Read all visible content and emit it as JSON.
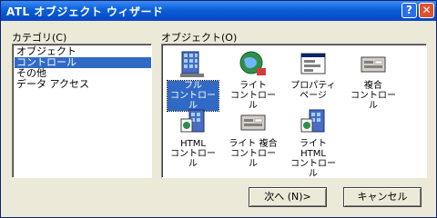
{
  "window": {
    "title": "ATL オブジェクト ウィザード",
    "help_label": "?",
    "close_label": "✕"
  },
  "category": {
    "label": "カテゴリ(C)",
    "items": [
      {
        "label": "オブジェクト"
      },
      {
        "label": "コントロール"
      },
      {
        "label": "その他"
      },
      {
        "label": "データ アクセス"
      }
    ],
    "selected": "コントロール"
  },
  "objects": {
    "label": "オブジェクト(O)",
    "items": [
      {
        "label": "フル\nコントロール",
        "icon": "full-control-icon"
      },
      {
        "label": "ライト\nコントロール",
        "icon": "lite-control-icon"
      },
      {
        "label": "プロパティ\nページ",
        "icon": "property-page-icon"
      },
      {
        "label": "複合\nコントロール",
        "icon": "composite-control-icon"
      },
      {
        "label": "HTML\nコントロール",
        "icon": "html-control-icon"
      },
      {
        "label": "ライト 複合\nコントロール",
        "icon": "lite-composite-control-icon"
      },
      {
        "label": "ライト HTML\nコントロール",
        "icon": "lite-html-control-icon"
      }
    ],
    "selected": "フル コントロール"
  },
  "buttons": {
    "next_label": "次へ (N)>",
    "cancel_label": "キャンセル"
  },
  "colors": {
    "selection": "#316ac5",
    "titlebar": "#0a5fd8",
    "dialog_face": "#ece9d8"
  }
}
